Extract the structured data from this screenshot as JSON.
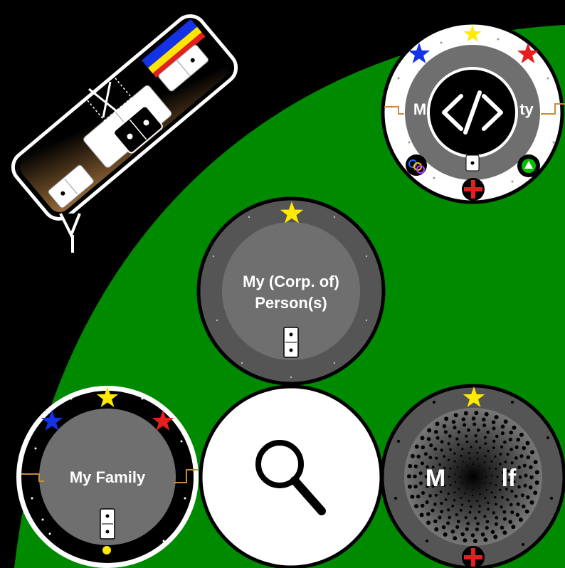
{
  "colors": {
    "background": "#000000",
    "field": "#008a00",
    "circle_gray": "#6f6f6f",
    "circle_dark": "#555555",
    "star_yellow": "#ffea00",
    "star_blue": "#1432e6",
    "star_red": "#e61e1e"
  },
  "tool_palette": {
    "label": "domino tool palette",
    "icons": [
      "crosshair-icon",
      "domino-icon"
    ]
  },
  "circles": {
    "community": {
      "label_left": "M",
      "label_right": "ty",
      "center_icon": "code-icon"
    },
    "corporation": {
      "label_line1": "My (Corp. of)",
      "label_line2": "Person(s)"
    },
    "family": {
      "label": "My Family"
    },
    "search": {
      "icon": "magnifier-icon"
    },
    "myself": {
      "label_left": "M",
      "label_right": "lf"
    }
  }
}
